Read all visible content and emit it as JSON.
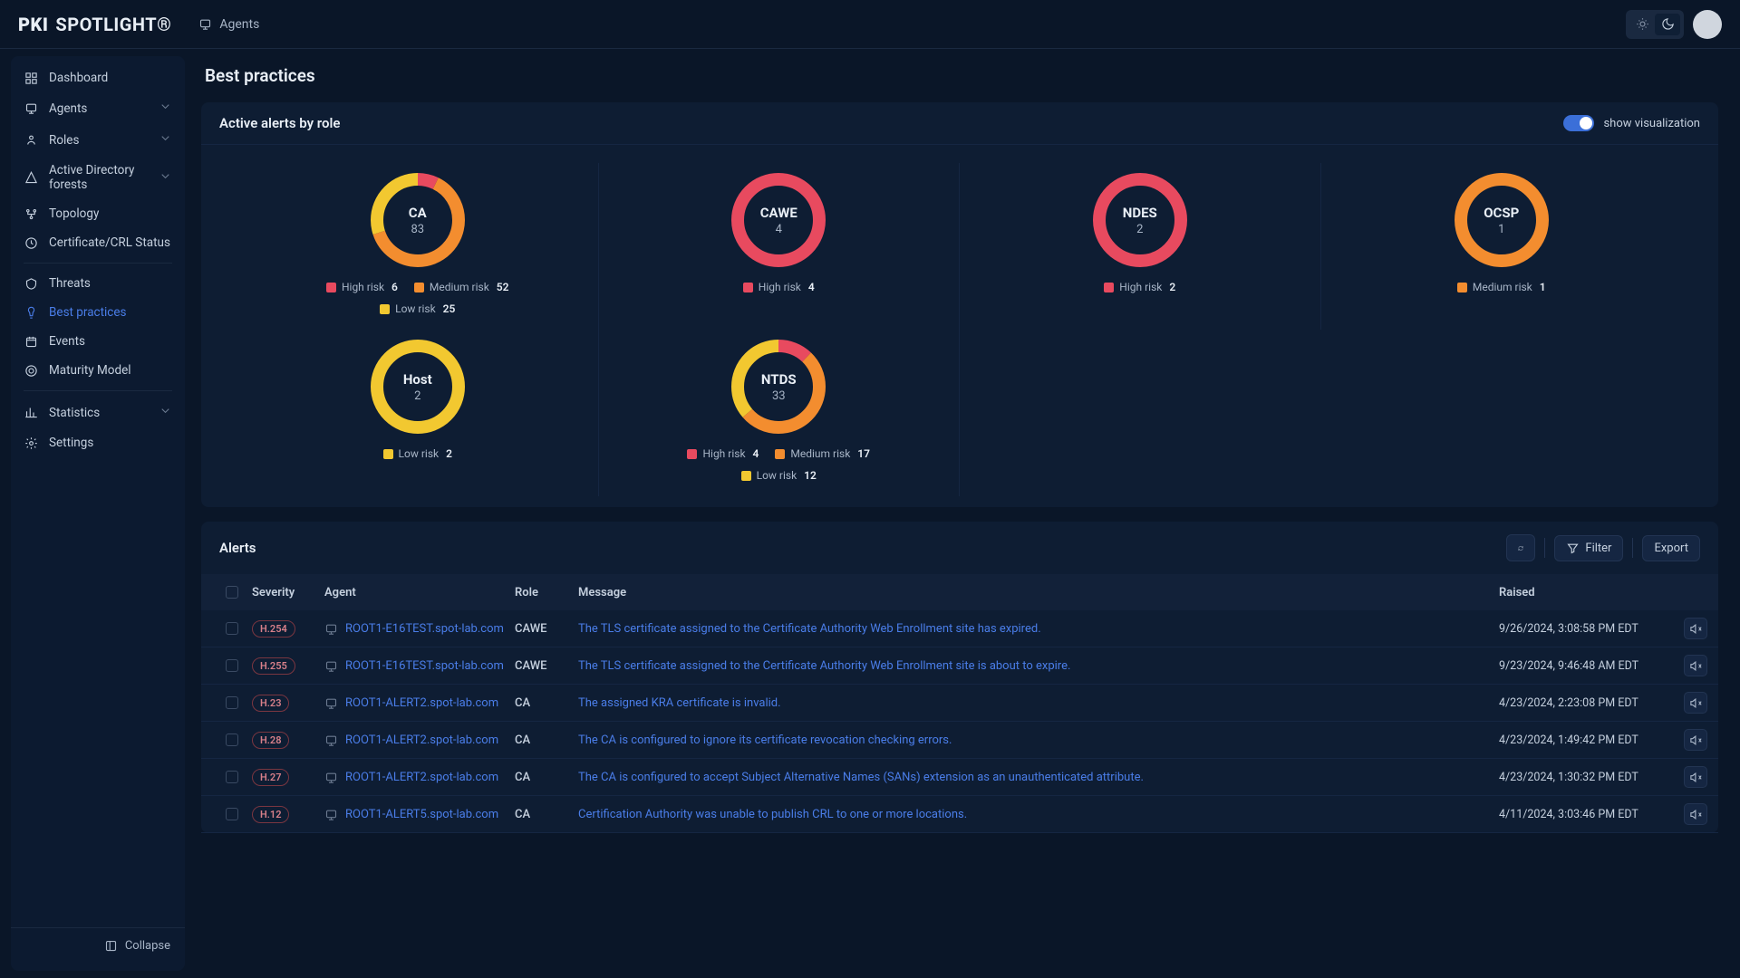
{
  "brand": {
    "left": "PKI",
    "right": "SPOTLIGHT®"
  },
  "topbar": {
    "tab": "Agents"
  },
  "sidebar": {
    "items": [
      {
        "label": "Dashboard",
        "hasChev": false
      },
      {
        "label": "Agents",
        "hasChev": true
      },
      {
        "label": "Roles",
        "hasChev": true
      },
      {
        "label": "Active Directory forests",
        "hasChev": true
      },
      {
        "label": "Topology",
        "hasChev": false
      },
      {
        "label": "Certificate/CRL Status",
        "hasChev": false
      }
    ],
    "items2": [
      {
        "label": "Threats",
        "hasChev": false
      },
      {
        "label": "Best practices",
        "hasChev": false,
        "active": true
      },
      {
        "label": "Events",
        "hasChev": false
      },
      {
        "label": "Maturity Model",
        "hasChev": false
      }
    ],
    "items3": [
      {
        "label": "Statistics",
        "hasChev": true
      },
      {
        "label": "Settings",
        "hasChev": false
      }
    ],
    "collapse": "Collapse"
  },
  "page": {
    "title": "Best practices"
  },
  "alertsPanel": {
    "title": "Active alerts by role",
    "toggleLabel": "show visualization"
  },
  "colors": {
    "high": "#e84a5f",
    "medium": "#f38d2f",
    "low": "#f2c830"
  },
  "chart_data": [
    {
      "type": "pie",
      "title": "CA",
      "total": 83,
      "series": [
        {
          "name": "High risk",
          "value": 6,
          "color": "#e84a5f"
        },
        {
          "name": "Medium risk",
          "value": 52,
          "color": "#f38d2f"
        },
        {
          "name": "Low risk",
          "value": 25,
          "color": "#f2c830"
        }
      ]
    },
    {
      "type": "pie",
      "title": "CAWE",
      "total": 4,
      "series": [
        {
          "name": "High risk",
          "value": 4,
          "color": "#e84a5f"
        }
      ]
    },
    {
      "type": "pie",
      "title": "NDES",
      "total": 2,
      "series": [
        {
          "name": "High risk",
          "value": 2,
          "color": "#e84a5f"
        }
      ]
    },
    {
      "type": "pie",
      "title": "OCSP",
      "total": 1,
      "series": [
        {
          "name": "Medium risk",
          "value": 1,
          "color": "#f38d2f"
        }
      ]
    },
    {
      "type": "pie",
      "title": "Host",
      "total": 2,
      "series": [
        {
          "name": "Low risk",
          "value": 2,
          "color": "#f2c830"
        }
      ]
    },
    {
      "type": "pie",
      "title": "NTDS",
      "total": 33,
      "series": [
        {
          "name": "High risk",
          "value": 4,
          "color": "#e84a5f"
        },
        {
          "name": "Medium risk",
          "value": 17,
          "color": "#f38d2f"
        },
        {
          "name": "Low risk",
          "value": 12,
          "color": "#f2c830"
        }
      ]
    }
  ],
  "alertsSection": {
    "title": "Alerts",
    "filter": "Filter",
    "export": "Export",
    "columns": {
      "severity": "Severity",
      "agent": "Agent",
      "role": "Role",
      "message": "Message",
      "raised": "Raised"
    },
    "rows": [
      {
        "severity": "H.254",
        "agent": "ROOT1-E16TEST.spot-lab.com",
        "role": "CAWE",
        "message": "The TLS certificate assigned to the Certificate Authority Web Enrollment site has expired.",
        "raised": "9/26/2024, 3:08:58 PM EDT"
      },
      {
        "severity": "H.255",
        "agent": "ROOT1-E16TEST.spot-lab.com",
        "role": "CAWE",
        "message": "The TLS certificate assigned to the Certificate Authority Web Enrollment site is about to expire.",
        "raised": "9/23/2024, 9:46:48 AM EDT"
      },
      {
        "severity": "H.23",
        "agent": "ROOT1-ALERT2.spot-lab.com",
        "role": "CA",
        "message": "The assigned KRA certificate is invalid.",
        "raised": "4/23/2024, 2:23:08 PM EDT"
      },
      {
        "severity": "H.28",
        "agent": "ROOT1-ALERT2.spot-lab.com",
        "role": "CA",
        "message": "The CA is configured to ignore its certificate revocation checking errors.",
        "raised": "4/23/2024, 1:49:42 PM EDT"
      },
      {
        "severity": "H.27",
        "agent": "ROOT1-ALERT2.spot-lab.com",
        "role": "CA",
        "message": "The CA is configured to accept Subject Alternative Names (SANs) extension as an unauthenticated attribute.",
        "raised": "4/23/2024, 1:30:32 PM EDT"
      },
      {
        "severity": "H.12",
        "agent": "ROOT1-ALERT5.spot-lab.com",
        "role": "CA",
        "message": "Certification Authority was unable to publish CRL to one or more locations.",
        "raised": "4/11/2024, 3:03:46 PM EDT"
      }
    ]
  }
}
